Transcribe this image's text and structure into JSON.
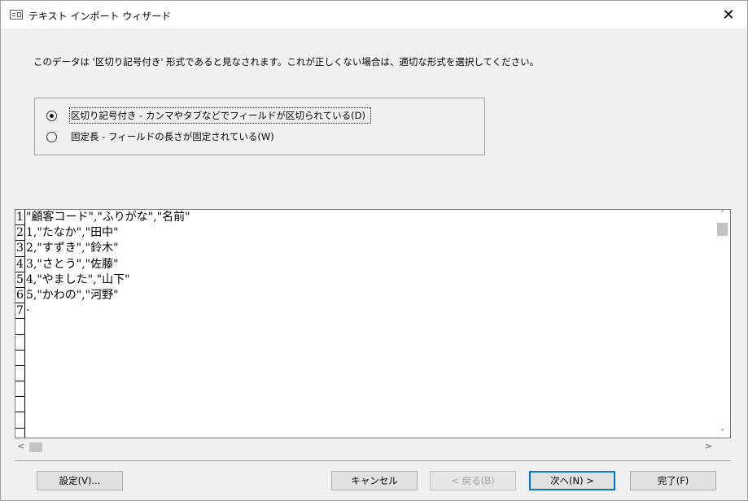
{
  "window": {
    "title": "テキスト インポート ウィザード",
    "close_glyph": "✕"
  },
  "description": "このデータは '区切り記号付き' 形式であると見なされます。これが正しくない場合は、適切な形式を選択してください。",
  "format_options": [
    {
      "label": "区切り記号付き - カンマやタブなどでフィールドが区切られている(D)",
      "checked": true
    },
    {
      "label": "固定長 - フィールドの長さが固定されている(W)",
      "checked": false
    }
  ],
  "preview": {
    "line_numbers": [
      "1",
      "2",
      "3",
      "4",
      "5",
      "6",
      "7",
      "",
      "",
      "",
      "",
      "",
      "",
      ""
    ],
    "lines": [
      "\"顧客コード\",\"ふりがな\",\"名前\"",
      "1,\"たなか\",\"田中\"",
      "2,\"すずき\",\"鈴木\"",
      "3,\"さとう\",\"佐藤\"",
      "4,\"やました\",\"山下\"",
      "5,\"かわの\",\"河野\"",
      "·"
    ]
  },
  "scrollbars": {
    "up_arrow": "˄",
    "down_arrow": "˅",
    "left_arrow": "<",
    "right_arrow": ">"
  },
  "buttons": {
    "settings": "設定(V)...",
    "cancel": "キャンセル",
    "back": "< 戻る(B)",
    "next": "次へ(N) >",
    "finish": "完了(F)"
  }
}
